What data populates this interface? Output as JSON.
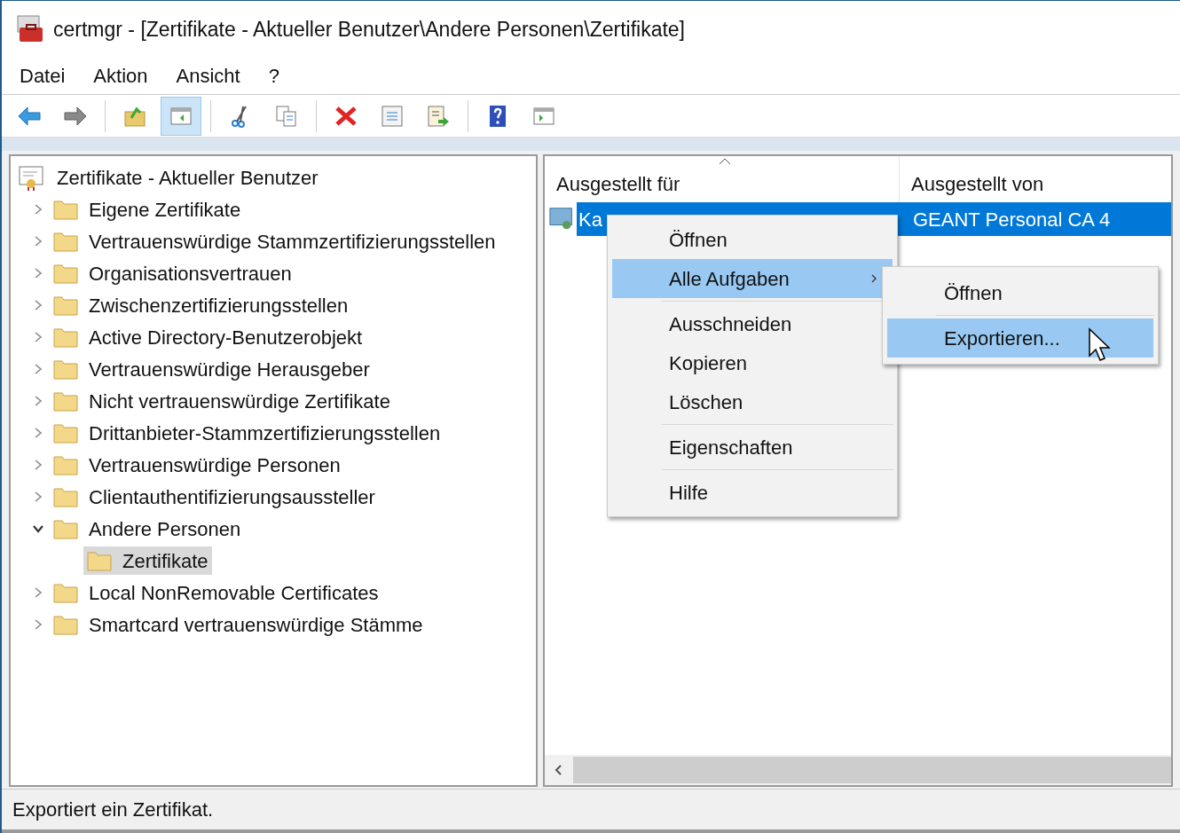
{
  "window": {
    "title": "certmgr - [Zertifikate - Aktueller Benutzer\\Andere Personen\\Zertifikate]"
  },
  "menu_bar": [
    "Datei",
    "Aktion",
    "Ansicht",
    "?"
  ],
  "toolbar": [
    {
      "kind": "back",
      "selected": false
    },
    {
      "kind": "forward",
      "selected": false
    },
    {
      "kind": "separator"
    },
    {
      "kind": "up",
      "selected": false
    },
    {
      "kind": "console",
      "selected": true
    },
    {
      "kind": "separator"
    },
    {
      "kind": "cut",
      "selected": false
    },
    {
      "kind": "copy",
      "selected": false
    },
    {
      "kind": "separator"
    },
    {
      "kind": "delete",
      "selected": false
    },
    {
      "kind": "properties",
      "selected": false
    },
    {
      "kind": "export",
      "selected": false
    },
    {
      "kind": "separator"
    },
    {
      "kind": "help",
      "selected": false
    },
    {
      "kind": "view",
      "selected": false
    }
  ],
  "tree": {
    "label": "Zertifikate - Aktueller Benutzer",
    "children": [
      {
        "label": "Eigene Zertifikate",
        "expanded": false,
        "selected": false
      },
      {
        "label": "Vertrauenswürdige Stammzertifizierungsstellen",
        "expanded": false,
        "selected": false
      },
      {
        "label": "Organisationsvertrauen",
        "expanded": false,
        "selected": false
      },
      {
        "label": "Zwischenzertifizierungsstellen",
        "expanded": false,
        "selected": false
      },
      {
        "label": "Active Directory-Benutzerobjekt",
        "expanded": false,
        "selected": false
      },
      {
        "label": "Vertrauenswürdige Herausgeber",
        "expanded": false,
        "selected": false
      },
      {
        "label": "Nicht vertrauenswürdige Zertifikate",
        "expanded": false,
        "selected": false
      },
      {
        "label": "Drittanbieter-Stammzertifizierungsstellen",
        "expanded": false,
        "selected": false
      },
      {
        "label": "Vertrauenswürdige Personen",
        "expanded": false,
        "selected": false
      },
      {
        "label": "Clientauthentifizierungsaussteller",
        "expanded": false,
        "selected": false
      },
      {
        "label": "Andere Personen",
        "expanded": true,
        "selected": false,
        "children": [
          {
            "label": "Zertifikate",
            "selected": true
          }
        ]
      },
      {
        "label": "Local NonRemovable Certificates",
        "expanded": false,
        "selected": false
      },
      {
        "label": "Smartcard vertrauenswürdige Stämme",
        "expanded": false,
        "selected": false
      }
    ]
  },
  "list": {
    "columns": [
      "Ausgestellt für",
      "Ausgestellt von"
    ],
    "rows": [
      {
        "cells": [
          "Ka",
          "GEANT Personal CA 4"
        ],
        "selected": true
      }
    ]
  },
  "context_menu": [
    {
      "kind": "item",
      "label": "Öffnen",
      "selected": false,
      "submenu": false
    },
    {
      "kind": "item",
      "label": "Alle Aufgaben",
      "selected": true,
      "submenu": true
    },
    {
      "kind": "separator"
    },
    {
      "kind": "item",
      "label": "Ausschneiden",
      "selected": false,
      "submenu": false
    },
    {
      "kind": "item",
      "label": "Kopieren",
      "selected": false,
      "submenu": false
    },
    {
      "kind": "item",
      "label": "Löschen",
      "selected": false,
      "submenu": false
    },
    {
      "kind": "separator"
    },
    {
      "kind": "item",
      "label": "Eigenschaften",
      "selected": false,
      "submenu": false
    },
    {
      "kind": "separator"
    },
    {
      "kind": "item",
      "label": "Hilfe",
      "selected": false,
      "submenu": false
    }
  ],
  "submenu": [
    {
      "kind": "item",
      "label": "Öffnen",
      "selected": false
    },
    {
      "kind": "separator"
    },
    {
      "kind": "item",
      "label": "Exportieren...",
      "selected": true
    }
  ],
  "status_bar": "Exportiert ein Zertifikat."
}
